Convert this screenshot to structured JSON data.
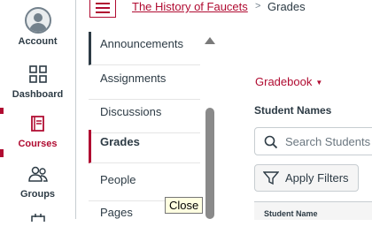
{
  "global_nav": {
    "items": [
      {
        "label": "Account",
        "icon": "user-avatar-icon"
      },
      {
        "label": "Dashboard",
        "icon": "dashboard-grid-icon"
      },
      {
        "label": "Courses",
        "icon": "book-icon",
        "active": true
      },
      {
        "label": "Groups",
        "icon": "people-icon"
      }
    ]
  },
  "header": {
    "course_link": "The History of Faucets",
    "separator": ">",
    "current": "Grades"
  },
  "course_nav": {
    "items": [
      "Announcements",
      "Assignments",
      "Discussions",
      "Grades",
      "People",
      "Pages"
    ],
    "selected": "Grades"
  },
  "tooltip": "Close",
  "main": {
    "gradebook_menu": "Gradebook",
    "student_names_label": "Student Names",
    "search_placeholder": "Search Students",
    "apply_filters_label": "Apply Filters",
    "table_header": "Student Name"
  },
  "colors": {
    "accent": "#b00b31",
    "text": "#2d3b45"
  }
}
